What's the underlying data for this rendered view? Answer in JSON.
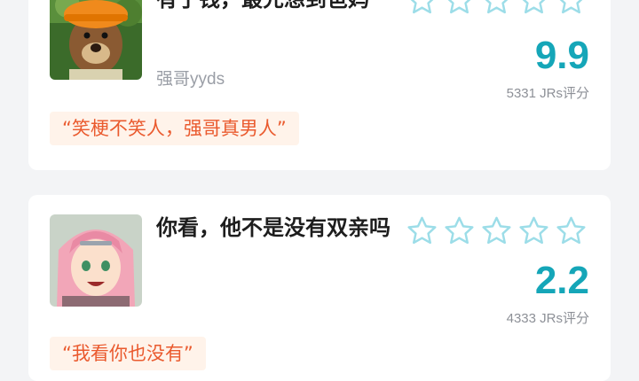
{
  "colors": {
    "accent": "#15a6b8",
    "star_outline": "#9cdde8",
    "quote_text": "#ea5a2e",
    "quote_bg": "#fff3ea"
  },
  "cards": [
    {
      "title": "有了钱，最先想到爸妈",
      "author": "强哥yyds",
      "score": "9.9",
      "rating_count": "5331 JRs评分",
      "quote": "“笑梗不笑人，强哥真男人”",
      "star_icon": "star-outline-icon",
      "thumbnail": "cartoon-bear-with-orange-hat"
    },
    {
      "title": "你看，他不是没有双亲吗",
      "score": "2.2",
      "rating_count": "4333 JRs评分",
      "quote": "“我看你也没有”",
      "star_icon": "star-outline-icon",
      "thumbnail": "anime-girl-pink-hair"
    }
  ]
}
